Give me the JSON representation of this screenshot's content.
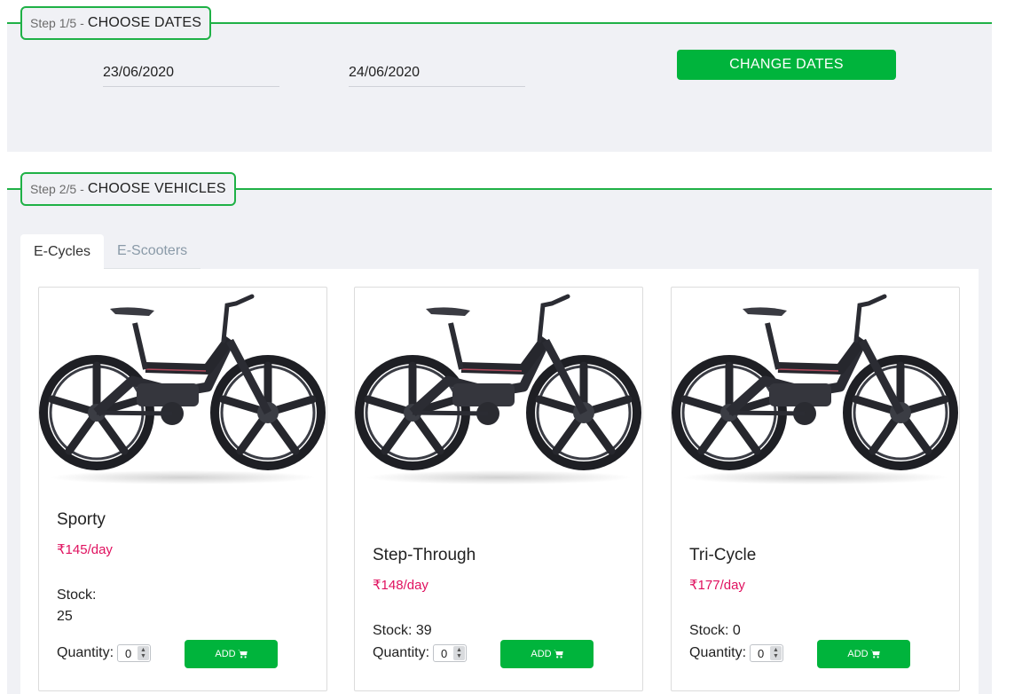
{
  "step1": {
    "number": "Step 1/5",
    "separator": "-",
    "title": "CHOOSE DATES",
    "date_from": "23/06/2020",
    "date_to": "24/06/2020",
    "change_button": "CHANGE DATES"
  },
  "step2": {
    "number": "Step 2/5",
    "separator": "-",
    "title": "CHOOSE VEHICLES",
    "tabs": [
      {
        "label": "E-Cycles",
        "active": true
      },
      {
        "label": "E-Scooters",
        "active": false
      }
    ]
  },
  "vehicles": [
    {
      "name": "Sporty",
      "price": "₹145/day",
      "stock_label": "Stock:",
      "stock_value": "25",
      "quantity_label": "Quantity:",
      "quantity": "0",
      "add_label": "ADD"
    },
    {
      "name": "Step-Through",
      "price": "₹148/day",
      "stock_label": "Stock: 39",
      "stock_value": "",
      "quantity_label": "Quantity:",
      "quantity": "0",
      "add_label": "ADD"
    },
    {
      "name": "Tri-Cycle",
      "price": "₹177/day",
      "stock_label": "Stock: 0",
      "stock_value": "",
      "quantity_label": "Quantity:",
      "quantity": "0",
      "add_label": "ADD"
    }
  ],
  "colors": {
    "accent": "#00b43c",
    "line": "#1fb146",
    "price": "#e0115f",
    "section_bg": "#f0f1f5"
  },
  "icons": {
    "cart": "shopping-cart-icon",
    "spinner": "spinner-arrows-icon",
    "product": "e-bike-image"
  }
}
